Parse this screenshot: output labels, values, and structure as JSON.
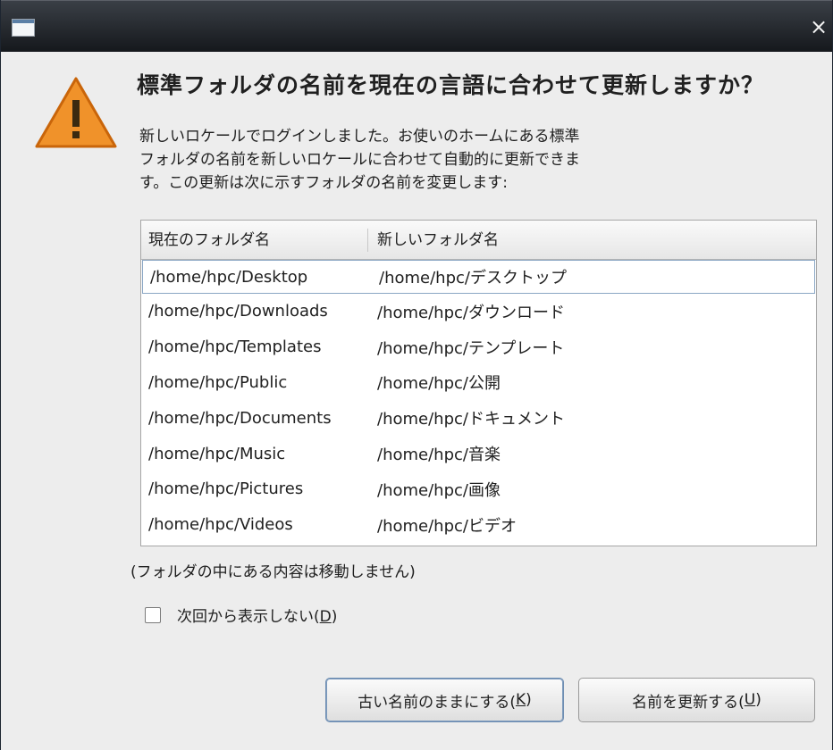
{
  "window": {
    "close_symbol": "×"
  },
  "dialog": {
    "icon": "warning-icon",
    "heading": "標準フォルダの名前を現在の言語に合わせて更新しますか？",
    "description": "新しいロケールでログインしました。お使いのホームにある標準\nフォルダの名前を新しいロケールに合わせて自動的に更新できま\nす。この更新は次に示すフォルダの名前を変更します:",
    "table": {
      "headers": [
        "現在のフォルダ名",
        "新しいフォルダ名"
      ],
      "rows": [
        [
          "/home/hpc/Desktop",
          "/home/hpc/デスクトップ"
        ],
        [
          "/home/hpc/Downloads",
          "/home/hpc/ダウンロード"
        ],
        [
          "/home/hpc/Templates",
          "/home/hpc/テンプレート"
        ],
        [
          "/home/hpc/Public",
          "/home/hpc/公開"
        ],
        [
          "/home/hpc/Documents",
          "/home/hpc/ドキュメント"
        ],
        [
          "/home/hpc/Music",
          "/home/hpc/音楽"
        ],
        [
          "/home/hpc/Pictures",
          "/home/hpc/画像"
        ],
        [
          "/home/hpc/Videos",
          "/home/hpc/ビデオ"
        ]
      ]
    },
    "note": "(フォルダの中にある内容は移動しません)",
    "checkbox": {
      "label_before": "次回から表示しない(",
      "mnemonic": "D",
      "label_after": ")",
      "checked": false
    },
    "buttons": {
      "keep": {
        "before": "古い名前のままにする(",
        "mnemonic": "K",
        "after": ")"
      },
      "update": {
        "before": "名前を更新する(",
        "mnemonic": "U",
        "after": ")"
      }
    }
  },
  "colors": {
    "warning_fill": "#f0922a",
    "warning_stroke": "#c9650a",
    "titlebar": "#1e2227",
    "dialog_bg": "#ededed"
  }
}
